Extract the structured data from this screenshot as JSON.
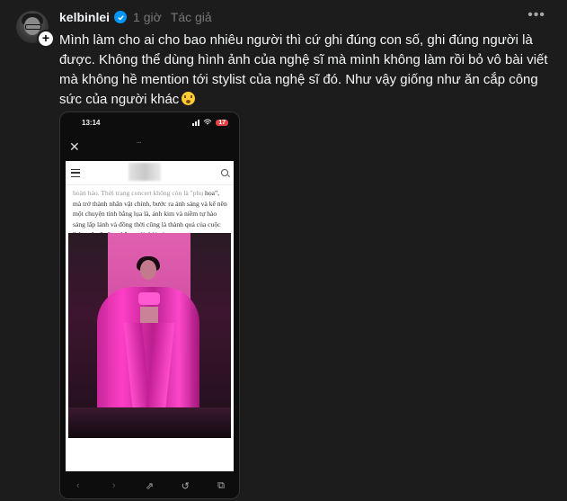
{
  "post": {
    "username": "kelbinlei",
    "time": "1 giờ",
    "author_tag": "Tác giả",
    "text": "Mình làm cho ai cho bao nhiêu người thì cứ ghi đúng con số, ghi đúng người là được. Không thể dùng hình ảnh của nghệ sĩ mà mình không làm rồi bỏ vô bài viết mà không hề mention tới stylist của nghệ sĩ đó. Như vậy giống như ăn cắp công sức của người khác"
  },
  "phone": {
    "status_time": "13:14",
    "battery": "17",
    "article_text_faded": "hoàn hảo. Thời trang concert không còn là \"phụ",
    "article_text": "họa\", mà trở thành nhân vật chính, bước ra ánh sáng và kể nên một chuyện tình bằng lụa là, ánh kim và niềm tự hào sáng lấp lánh và đồng thời cũng là thành quả của cuộc \"chạy đua\" căng thẳng với thời gian."
  },
  "icons": {
    "verified": "verified-badge-icon",
    "more": "more-icon",
    "follow": "plus-icon",
    "close": "close-icon",
    "menu": "menu-icon",
    "search": "search-icon",
    "back": "chevron-left-icon",
    "forward": "chevron-right-icon",
    "share": "share-icon",
    "history": "history-icon",
    "tabs": "tabs-icon"
  },
  "colors": {
    "background": "#1c1c1c",
    "verified": "#0095f6",
    "battery": "#e04444",
    "accent_pink": "#ff3ec8"
  }
}
